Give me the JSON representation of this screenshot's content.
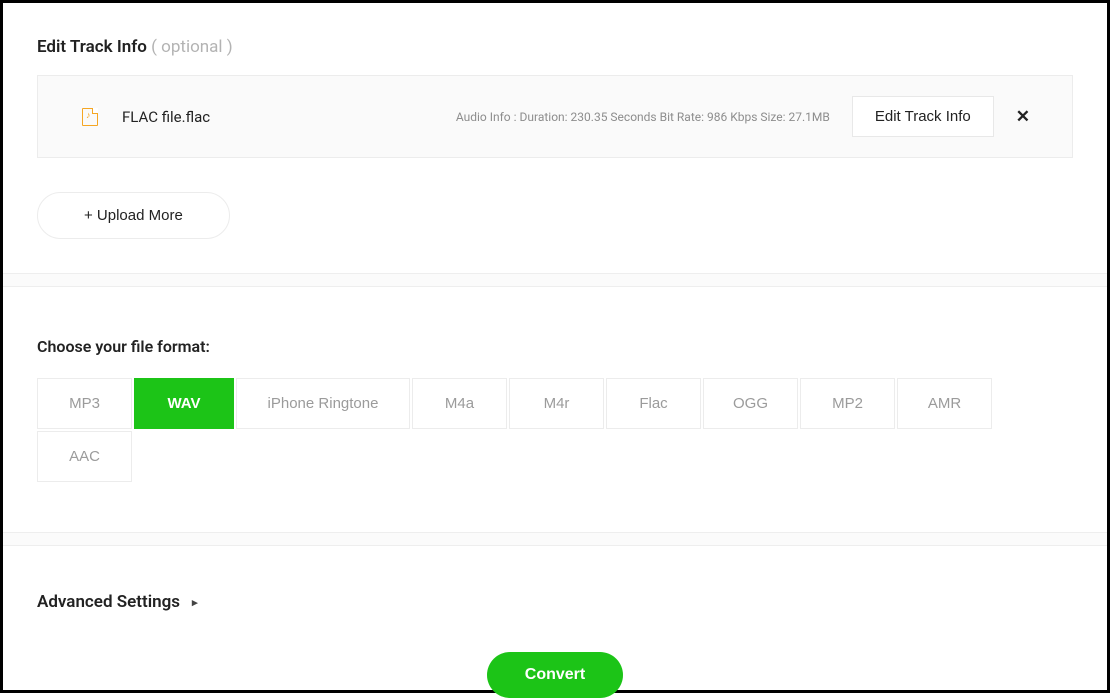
{
  "section1": {
    "title_main": "Edit Track Info",
    "title_suffix": " ( optional )"
  },
  "file": {
    "name": "FLAC file.flac",
    "info": "Audio Info : Duration: 230.35 Seconds Bit Rate: 986 Kbps Size: 27.1MB",
    "edit_label": "Edit Track Info",
    "close_glyph": "✕"
  },
  "upload_more_label": "+ Upload More",
  "format_section": {
    "title": "Choose your file format:",
    "items": [
      {
        "label": "MP3",
        "active": false,
        "wide": false
      },
      {
        "label": "WAV",
        "active": true,
        "wide": false
      },
      {
        "label": "iPhone Ringtone",
        "active": false,
        "wide": true
      },
      {
        "label": "M4a",
        "active": false,
        "wide": false
      },
      {
        "label": "M4r",
        "active": false,
        "wide": false
      },
      {
        "label": "Flac",
        "active": false,
        "wide": false
      },
      {
        "label": "OGG",
        "active": false,
        "wide": false
      },
      {
        "label": "MP2",
        "active": false,
        "wide": false
      },
      {
        "label": "AMR",
        "active": false,
        "wide": false
      },
      {
        "label": "AAC",
        "active": false,
        "wide": false
      }
    ]
  },
  "advanced": {
    "title": "Advanced Settings",
    "chevron": "▸"
  },
  "convert_label": "Convert"
}
